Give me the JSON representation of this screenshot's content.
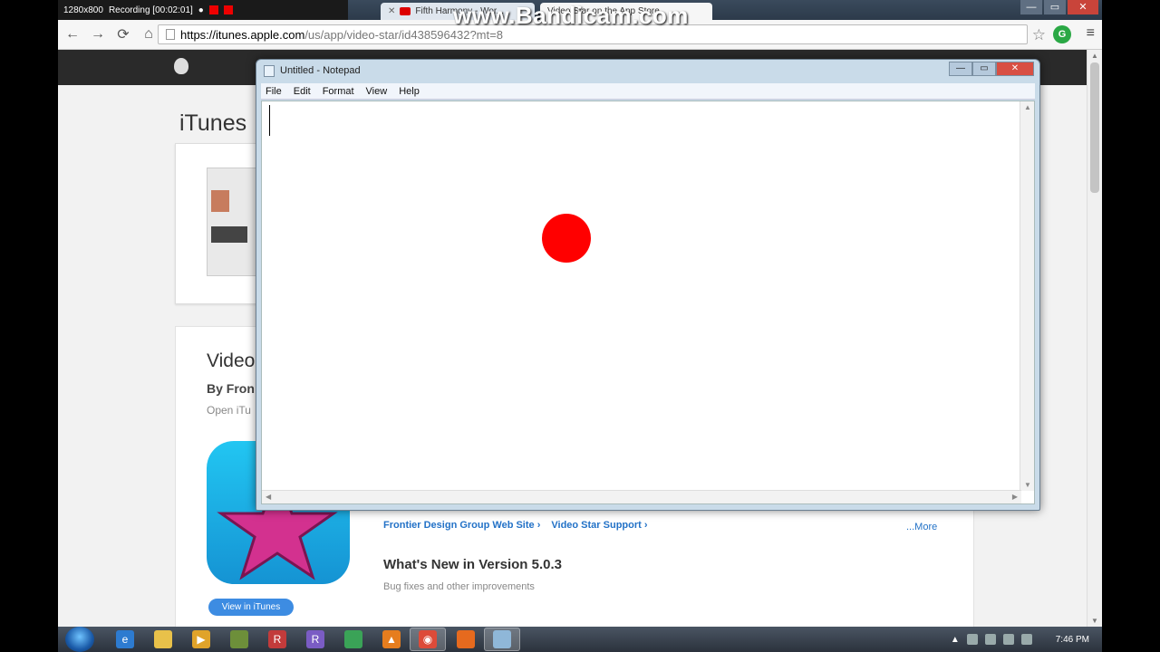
{
  "recorder": {
    "resolution": "1280x800",
    "status": "Recording [00:02:01]",
    "watermark": "www.Bandicam.com"
  },
  "browser": {
    "tabs": [
      {
        "label": "Fifth Harmony - Wor...",
        "favicon": "youtube-icon"
      },
      {
        "label": "Video Star on the App Store",
        "favicon": "page-icon"
      }
    ],
    "url_host": "https://itunes.apple.com",
    "url_rest": "/us/app/video-star/id438596432?mt=8",
    "nav": {
      "back": "←",
      "forward": "→",
      "reload": "⟳",
      "home": "⌂"
    },
    "icons": {
      "bookmark": "☆",
      "menu": "≡",
      "extension": "G"
    }
  },
  "itunes_page": {
    "heading": "iTunes",
    "app_name": "Video",
    "by_line": "By Fron",
    "open_line": "Open iTu",
    "links": [
      "Frontier Design Group Web Site ›",
      "Video Star Support ›"
    ],
    "more_link": "...More",
    "whats_new_title": "What's New in Version 5.0.3",
    "whats_new_text": "Bug fixes and other improvements",
    "view_button": "View in iTunes"
  },
  "notepad": {
    "title": "Untitled - Notepad",
    "menu": [
      "File",
      "Edit",
      "Format",
      "View",
      "Help"
    ],
    "content": "",
    "controls": {
      "minimize": "—",
      "maximize": "▭",
      "close": "✕"
    }
  },
  "taskbar": {
    "clock": "7:46 PM",
    "pinned": [
      "internet-explorer-icon",
      "file-explorer-icon",
      "media-player-icon",
      "minecraft-icon",
      "app-r-icon",
      "app-r2-icon",
      "messenger-icon",
      "vlc-icon",
      "chrome-icon",
      "firefox-icon",
      "notepad-icon"
    ]
  },
  "colors": {
    "accent": "#3d8ce2",
    "record_dot": "#ff0000",
    "link": "#2372c7"
  }
}
